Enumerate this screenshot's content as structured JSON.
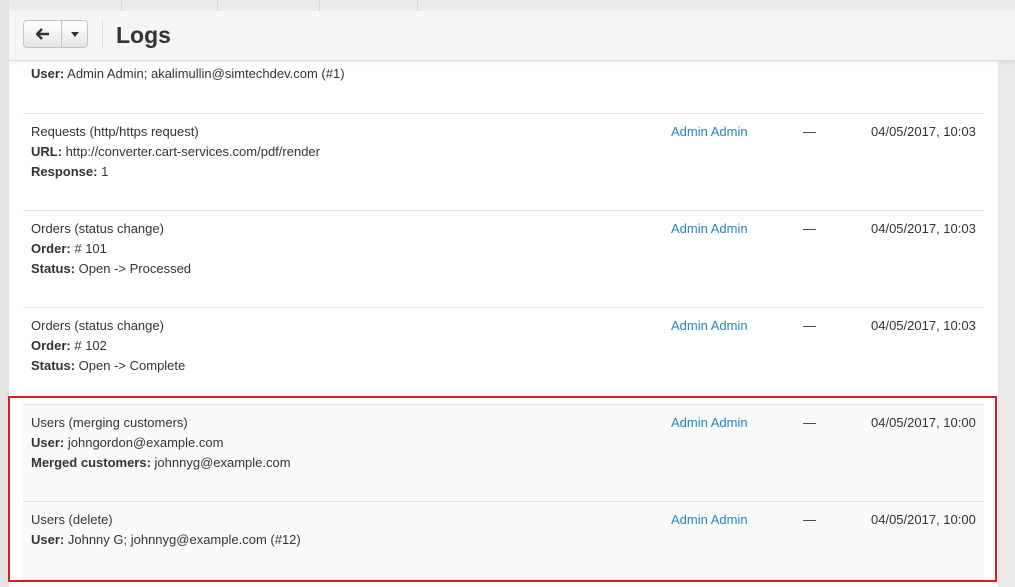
{
  "header": {
    "title": "Logs"
  },
  "entries": [
    {
      "lines": [
        {
          "label": "User:",
          "value": " Admin Admin; akalimullin@simtechdev.com (#1)"
        }
      ]
    },
    {
      "type": "Requests (http/https request)",
      "lines": [
        {
          "label": "URL:",
          "value": " http://converter.cart-services.com/pdf/render"
        },
        {
          "label": "Response:",
          "value": " 1"
        }
      ],
      "user": "Admin Admin",
      "ip": "—",
      "date": "04/05/2017, 10:03"
    },
    {
      "type": "Orders (status change)",
      "lines": [
        {
          "label": "Order:",
          "value": " # 101"
        },
        {
          "label": "Status:",
          "value": " Open -> Processed"
        }
      ],
      "user": "Admin Admin",
      "ip": "—",
      "date": "04/05/2017, 10:03"
    },
    {
      "type": "Orders (status change)",
      "lines": [
        {
          "label": "Order:",
          "value": " # 102"
        },
        {
          "label": "Status:",
          "value": " Open -> Complete"
        }
      ],
      "user": "Admin Admin",
      "ip": "—",
      "date": "04/05/2017, 10:03"
    },
    {
      "type": "Users (merging customers)",
      "lines": [
        {
          "label": "User:",
          "value": " johngordon@example.com"
        },
        {
          "label": "Merged customers:",
          "value": " johnnyg@example.com"
        }
      ],
      "user": "Admin Admin",
      "ip": "—",
      "date": "04/05/2017, 10:00"
    },
    {
      "type": "Users (delete)",
      "lines": [
        {
          "label": "User:",
          "value": " Johnny G; johnnyg@example.com (#12)"
        }
      ],
      "user": "Admin Admin",
      "ip": "—",
      "date": "04/05/2017, 10:00"
    }
  ],
  "colors": {
    "link": "#2a84c4",
    "highlight_border": "#d62020"
  },
  "icons": {
    "back": "arrow-left-icon",
    "dropdown": "caret-down-icon"
  }
}
